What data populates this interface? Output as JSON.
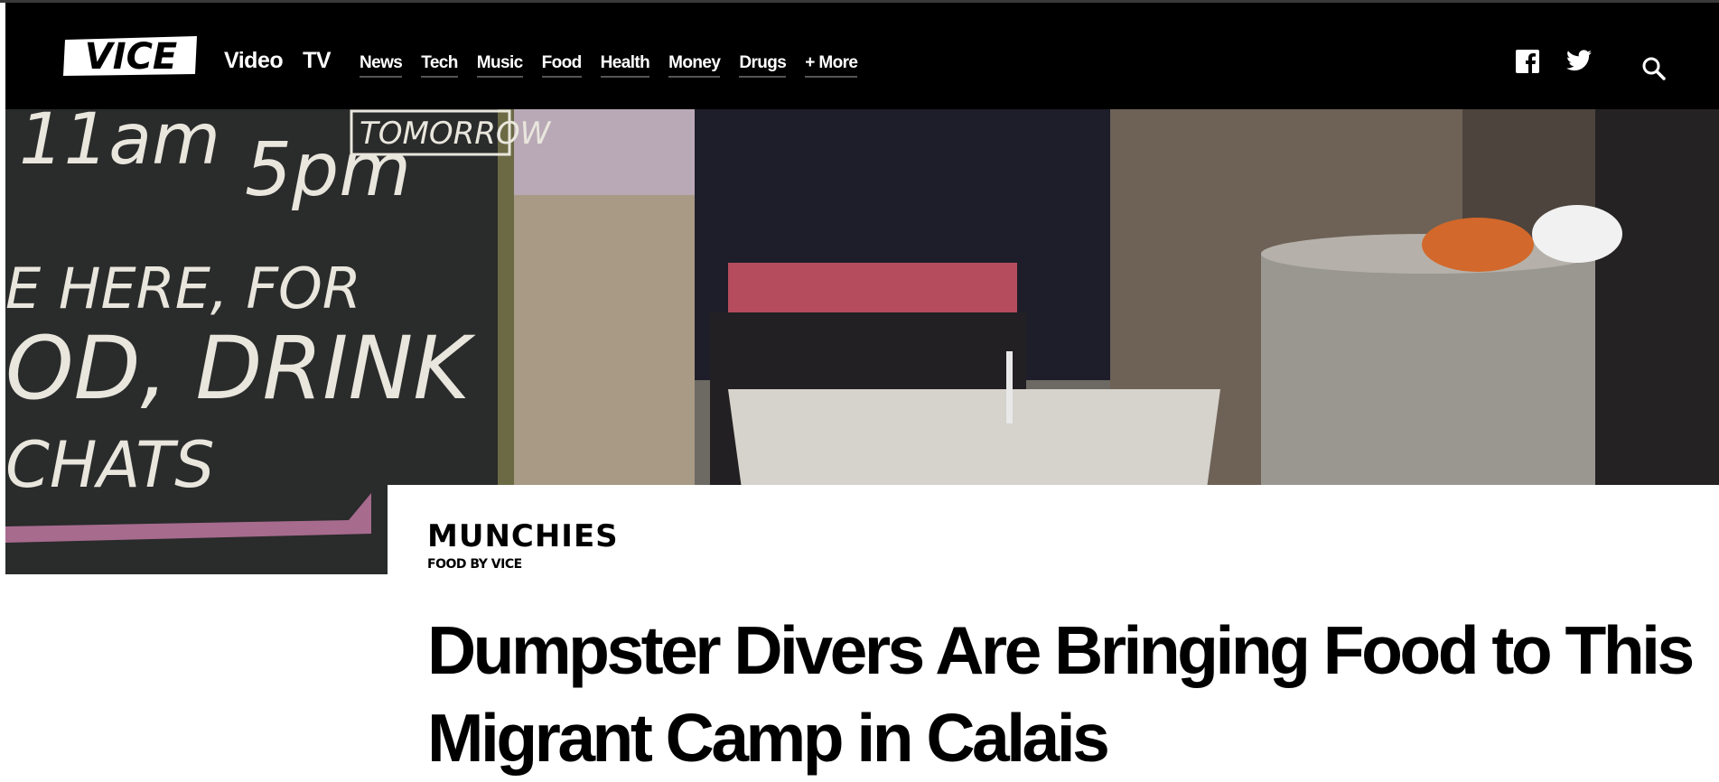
{
  "nav": {
    "logo_text": "VICE",
    "primary": [
      {
        "label": "Video"
      },
      {
        "label": "TV"
      }
    ],
    "sections": [
      {
        "label": "News"
      },
      {
        "label": "Tech"
      },
      {
        "label": "Music"
      },
      {
        "label": "Food"
      },
      {
        "label": "Health"
      },
      {
        "label": "Money"
      },
      {
        "label": "Drugs"
      },
      {
        "label": "+ More"
      }
    ],
    "social_icons": [
      "facebook-icon",
      "twitter-icon"
    ],
    "search_icon": "search-icon"
  },
  "hero": {
    "chalkboard_lines": [
      "11am",
      "5pm",
      "TOMORROW",
      "E HERE, FOR",
      "OD, DRINK",
      "CHATS"
    ]
  },
  "article": {
    "brand": "MUNCHIES",
    "brand_tagline": "FOOD BY VICE",
    "headline": "Dumpster Divers Are Bringing Food to This Migrant Camp in Calais"
  },
  "colors": {
    "nav_background": "#000000",
    "text": "#000000",
    "nav_text": "#ffffff"
  }
}
